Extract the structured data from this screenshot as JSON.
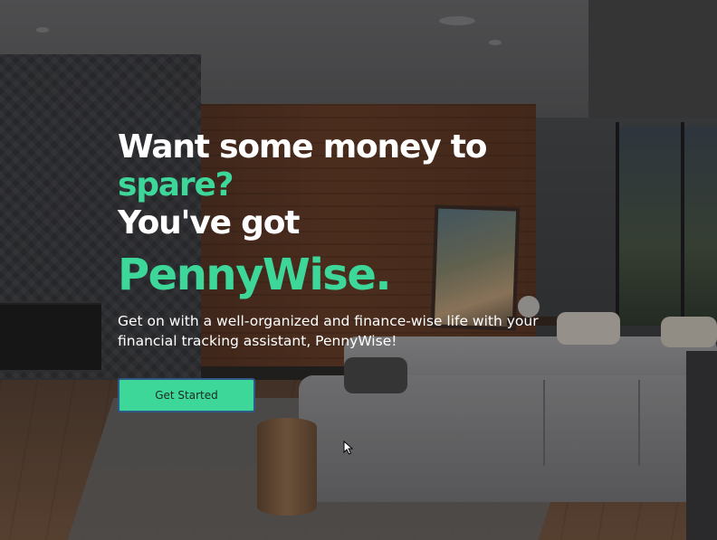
{
  "hero": {
    "headline_line1": "Want some money to",
    "headline_line2": "spare?",
    "headline_line3": "You've got",
    "brand_name": "PennyWise.",
    "description": "Get on with a well-organized and finance-wise life with your financial tracking assistant, PennyWise!",
    "cta_label": "Get Started"
  },
  "colors": {
    "accent": "#3ed79a",
    "text": "#ffffff",
    "button_border": "#2f5a87"
  },
  "icons": {
    "cursor": "mouse-pointer-icon"
  }
}
